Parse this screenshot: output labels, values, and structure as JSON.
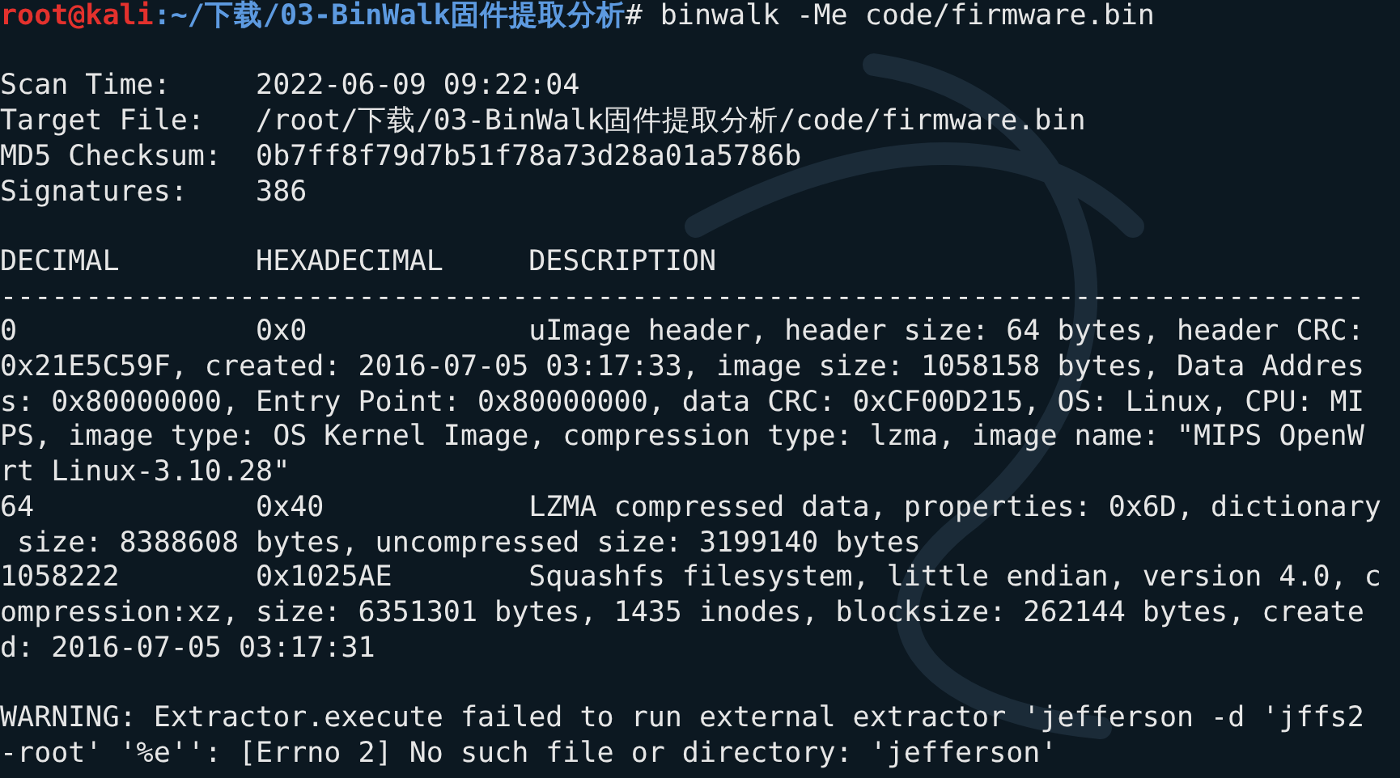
{
  "prompt": {
    "user_host": "root@kali",
    "path": ":~/下载/03-BinWalk固件提取分析",
    "symbol": "#",
    "command": "binwalk -Me code/firmware.bin"
  },
  "scan_info": [
    {
      "label": "Scan Time:",
      "value": "2022-06-09 09:22:04"
    },
    {
      "label": "Target File:",
      "value": "/root/下载/03-BinWalk固件提取分析/code/firmware.bin"
    },
    {
      "label": "MD5 Checksum:",
      "value": "0b7ff8f79d7b51f78a73d28a01a5786b"
    },
    {
      "label": "Signatures:",
      "value": "386"
    }
  ],
  "columns": [
    "DECIMAL",
    "HEXADECIMAL",
    "DESCRIPTION"
  ],
  "separator": "--------------------------------------------------------------------------------",
  "results": [
    {
      "decimal": "0",
      "hexadecimal": "0x0",
      "description": [
        "uImage header, header size: 64 bytes, header CRC:",
        "0x21E5C59F, created: 2016-07-05 03:17:33, image size: 1058158 bytes, Data Addres",
        "s: 0x80000000, Entry Point: 0x80000000, data CRC: 0xCF00D215, OS: Linux, CPU: MI",
        "PS, image type: OS Kernel Image, compression type: lzma, image name: \"MIPS OpenW",
        "rt Linux-3.10.28\""
      ]
    },
    {
      "decimal": "64",
      "hexadecimal": "0x40",
      "description": [
        "LZMA compressed data, properties: 0x6D, dictionary",
        " size: 8388608 bytes, uncompressed size: 3199140 bytes"
      ]
    },
    {
      "decimal": "1058222",
      "hexadecimal": "0x1025AE",
      "description": [
        "Squashfs filesystem, little endian, version 4.0, c",
        "ompression:xz, size: 6351301 bytes, 1435 inodes, blocksize: 262144 bytes, create",
        "d: 2016-07-05 03:17:31"
      ]
    }
  ],
  "warning": [
    "WARNING: Extractor.execute failed to run external extractor 'jefferson -d 'jffs2",
    "-root' '%e'': [Errno 2] No such file or directory: 'jefferson'"
  ]
}
